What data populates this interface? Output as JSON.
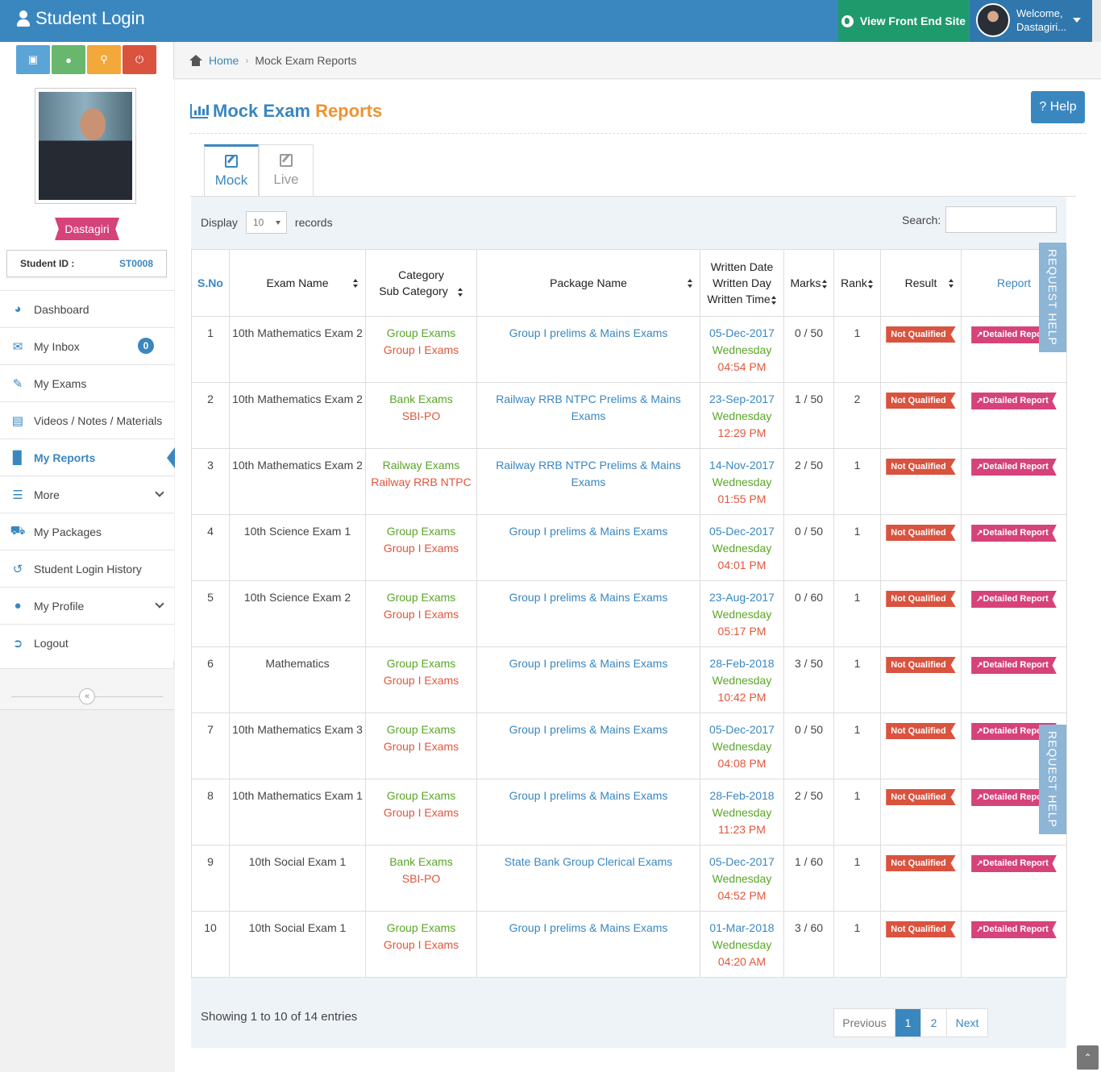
{
  "header": {
    "brand": "Student Login",
    "front_end_label": "View Front End Site",
    "welcome_line1": "Welcome,",
    "welcome_line2": "Dastagiri..."
  },
  "sidebar": {
    "student_name": "Dastagiri",
    "student_id_label": "Student ID :",
    "student_id": "ST0008",
    "inbox_count": "0",
    "items": [
      {
        "label": "Dashboard",
        "icon": "dashboard-icon"
      },
      {
        "label": "My Inbox",
        "icon": "envelope-icon"
      },
      {
        "label": "My Exams",
        "icon": "edit-icon"
      },
      {
        "label": "Videos / Notes / Materials",
        "icon": "file-icon"
      },
      {
        "label": "My Reports",
        "icon": "bar-chart-icon"
      },
      {
        "label": "More",
        "icon": "menu-icon"
      },
      {
        "label": "My Packages",
        "icon": "cart-icon"
      },
      {
        "label": "Student Login History",
        "icon": "history-icon"
      },
      {
        "label": "My Profile",
        "icon": "user-icon"
      },
      {
        "label": "Logout",
        "icon": "logout-icon"
      }
    ]
  },
  "breadcrumb": {
    "home": "Home",
    "current": "Mock Exam Reports"
  },
  "page": {
    "title_part1": "Mock Exam",
    "title_part2": "Reports",
    "help_label": "? Help",
    "tabs": [
      "Mock",
      "Live"
    ]
  },
  "table_controls": {
    "display_label": "Display",
    "display_value": "10",
    "records_label": "records",
    "search_label": "Search:",
    "request_help": "REQUEST HELP"
  },
  "columns": {
    "sno": "S.No",
    "exam_name": "Exam Name",
    "category": "Category",
    "sub_category": "Sub Category",
    "package": "Package Name",
    "written_date": "Written Date",
    "written_day": "Written Day",
    "written_time": "Written Time",
    "marks": "Marks",
    "rank": "Rank",
    "result": "Result",
    "report": "Report"
  },
  "rows": [
    {
      "sno": "1",
      "exam": "10th Mathematics Exam 2",
      "cat": "Group Exams",
      "sub": "Group I Exams",
      "pkg": "Group I prelims & Mains Exams",
      "date": "05-Dec-2017",
      "day": "Wednesday",
      "time": "04:54 PM",
      "marks": "0 / 50",
      "rank": "1",
      "result": "Not Qualified",
      "report": "Detailed Report"
    },
    {
      "sno": "2",
      "exam": "10th Mathematics Exam 2",
      "cat": "Bank Exams",
      "sub": "SBI-PO",
      "pkg": "Railway RRB NTPC Prelims & Mains Exams",
      "date": "23-Sep-2017",
      "day": "Wednesday",
      "time": "12:29 PM",
      "marks": "1 / 50",
      "rank": "2",
      "result": "Not Qualified",
      "report": "Detailed Report"
    },
    {
      "sno": "3",
      "exam": "10th Mathematics Exam 2",
      "cat": "Railway Exams",
      "sub": "Railway RRB NTPC",
      "pkg": "Railway RRB NTPC Prelims & Mains Exams",
      "date": "14-Nov-2017",
      "day": "Wednesday",
      "time": "01:55 PM",
      "marks": "2 / 50",
      "rank": "1",
      "result": "Not Qualified",
      "report": "Detailed Report"
    },
    {
      "sno": "4",
      "exam": "10th Science Exam 1",
      "cat": "Group Exams",
      "sub": "Group I Exams",
      "pkg": "Group I prelims & Mains Exams",
      "date": "05-Dec-2017",
      "day": "Wednesday",
      "time": "04:01 PM",
      "marks": "0 / 50",
      "rank": "1",
      "result": "Not Qualified",
      "report": "Detailed Report"
    },
    {
      "sno": "5",
      "exam": "10th Science Exam 2",
      "cat": "Group Exams",
      "sub": "Group I Exams",
      "pkg": "Group I prelims & Mains Exams",
      "date": "23-Aug-2017",
      "day": "Wednesday",
      "time": "05:17 PM",
      "marks": "0 / 60",
      "rank": "1",
      "result": "Not Qualified",
      "report": "Detailed Report"
    },
    {
      "sno": "6",
      "exam": "Mathematics",
      "cat": "Group Exams",
      "sub": "Group I Exams",
      "pkg": "Group I prelims & Mains Exams",
      "date": "28-Feb-2018",
      "day": "Wednesday",
      "time": "10:42 PM",
      "marks": "3 / 50",
      "rank": "1",
      "result": "Not Qualified",
      "report": "Detailed Report"
    },
    {
      "sno": "7",
      "exam": "10th Mathematics Exam 3",
      "cat": "Group Exams",
      "sub": "Group I Exams",
      "pkg": "Group I prelims & Mains Exams",
      "date": "05-Dec-2017",
      "day": "Wednesday",
      "time": "04:08 PM",
      "marks": "0 / 50",
      "rank": "1",
      "result": "Not Qualified",
      "report": "Detailed Report"
    },
    {
      "sno": "8",
      "exam": "10th Mathematics Exam 1",
      "cat": "Group Exams",
      "sub": "Group I Exams",
      "pkg": "Group I prelims & Mains Exams",
      "date": "28-Feb-2018",
      "day": "Wednesday",
      "time": "11:23 PM",
      "marks": "2 / 50",
      "rank": "1",
      "result": "Not Qualified",
      "report": "Detailed Report"
    },
    {
      "sno": "9",
      "exam": "10th Social Exam 1",
      "cat": "Bank Exams",
      "sub": "SBI-PO",
      "pkg": "State Bank Group Clerical Exams",
      "date": "05-Dec-2017",
      "day": "Wednesday",
      "time": "04:52 PM",
      "marks": "1 / 60",
      "rank": "1",
      "result": "Not Qualified",
      "report": "Detailed Report"
    },
    {
      "sno": "10",
      "exam": "10th Social Exam 1",
      "cat": "Group Exams",
      "sub": "Group I Exams",
      "pkg": "Group I prelims & Mains Exams",
      "date": "01-Mar-2018",
      "day": "Wednesday",
      "time": "04:20 AM",
      "marks": "3 / 60",
      "rank": "1",
      "result": "Not Qualified",
      "report": "Detailed Report"
    }
  ],
  "footer": {
    "showing": "Showing 1 to 10 of 14 entries",
    "prev": "Previous",
    "pages": [
      "1",
      "2"
    ],
    "next": "Next"
  }
}
